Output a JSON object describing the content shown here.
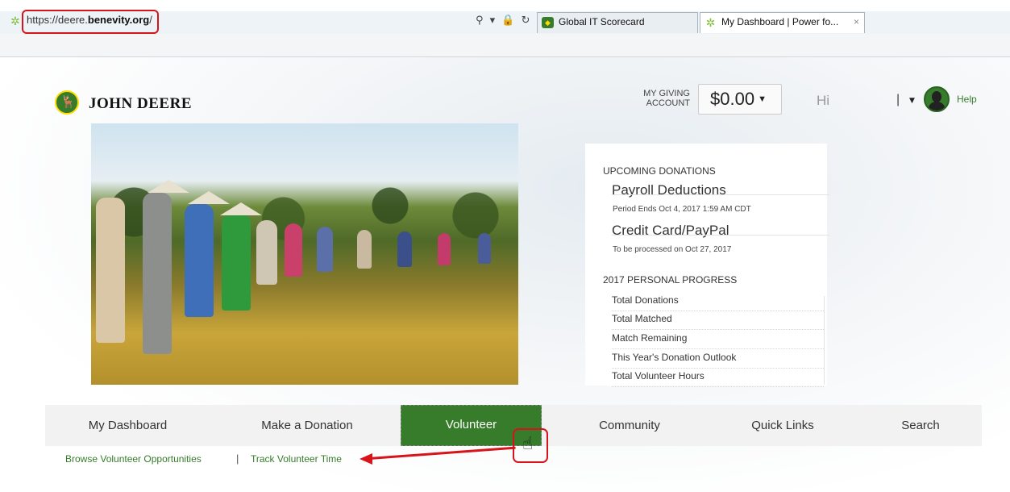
{
  "browser": {
    "url_prefix": "https://deere.",
    "url_domain": "benevity.org",
    "url_suffix": "/",
    "address_icons": "⚲ ▾ 🔒 ↻",
    "tabs": [
      {
        "label": "Global IT Scorecard",
        "active": false
      },
      {
        "label": "My Dashboard | Power fo...",
        "active": true,
        "close": "×"
      }
    ]
  },
  "header": {
    "brand": "JOHN DEERE",
    "giving_label": "MY GIVING ACCOUNT",
    "giving_amount": "$0.00",
    "giving_caret": "▼",
    "greeting": "Hi",
    "user_separator": "|",
    "user_caret": "▼",
    "help": "Help"
  },
  "summary": {
    "upcoming_title": "UPCOMING DONATIONS",
    "payroll_title": "Payroll Deductions",
    "payroll_note": "Period Ends Oct 4, 2017 1:59 AM CDT",
    "card_title": "Credit Card/PayPal",
    "card_note": "To be processed on Oct 27, 2017",
    "progress_title": "2017 PERSONAL PROGRESS",
    "progress_rows": [
      "Total Donations",
      "Total Matched",
      "Match Remaining",
      "This Year's Donation Outlook",
      "Total Volunteer Hours"
    ]
  },
  "nav": {
    "items": [
      "My Dashboard",
      "Make a Donation",
      "Volunteer",
      "Community",
      "Quick Links",
      "Search"
    ],
    "active": "Volunteer"
  },
  "subnav": {
    "items": [
      "Browse Volunteer Opportunities",
      "Track Volunteer Time"
    ],
    "separator": "|"
  },
  "colors": {
    "brand_green": "#367c2b",
    "brand_yellow": "#ffde00",
    "annotation_red": "#d7141a"
  }
}
